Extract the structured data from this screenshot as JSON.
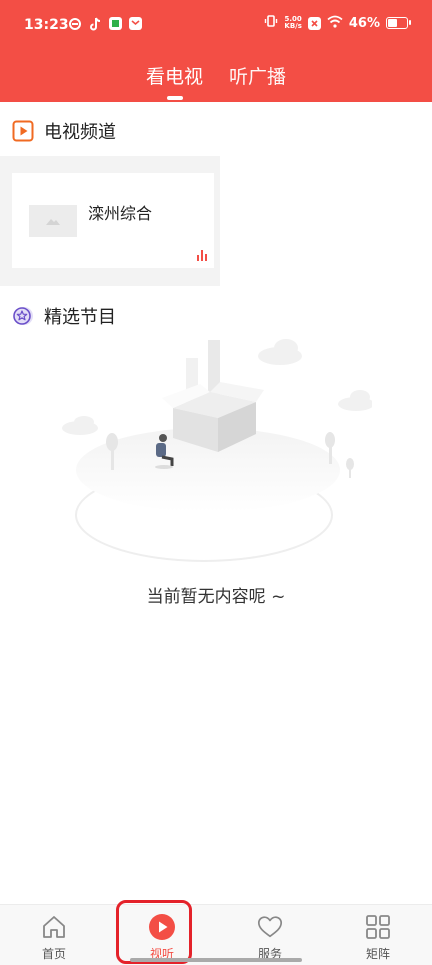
{
  "status_bar": {
    "time": "13:23",
    "net_speed_value": "5.00",
    "net_speed_unit": "KB/s",
    "battery_percent": "46%",
    "battery_level": 0.46
  },
  "tabs": [
    {
      "label": "看电视",
      "active": true
    },
    {
      "label": "听广播",
      "active": false
    }
  ],
  "tv_section": {
    "title": "电视频道",
    "channels": [
      {
        "name": "滦州综合"
      }
    ]
  },
  "featured_section": {
    "title": "精选节目",
    "empty_message": "当前暂无内容呢 ~"
  },
  "bottom_nav": [
    {
      "label": "首页",
      "icon": "home-icon",
      "active": false
    },
    {
      "label": "视听",
      "icon": "play-icon",
      "active": true
    },
    {
      "label": "服务",
      "icon": "heart-icon",
      "active": false
    },
    {
      "label": "矩阵",
      "icon": "grid-icon",
      "active": false
    }
  ],
  "colors": {
    "brand": "#f34e45",
    "highlight": "#e4222a",
    "tv_icon": "#f06a22",
    "featured_icon": "#6a4fc9"
  }
}
